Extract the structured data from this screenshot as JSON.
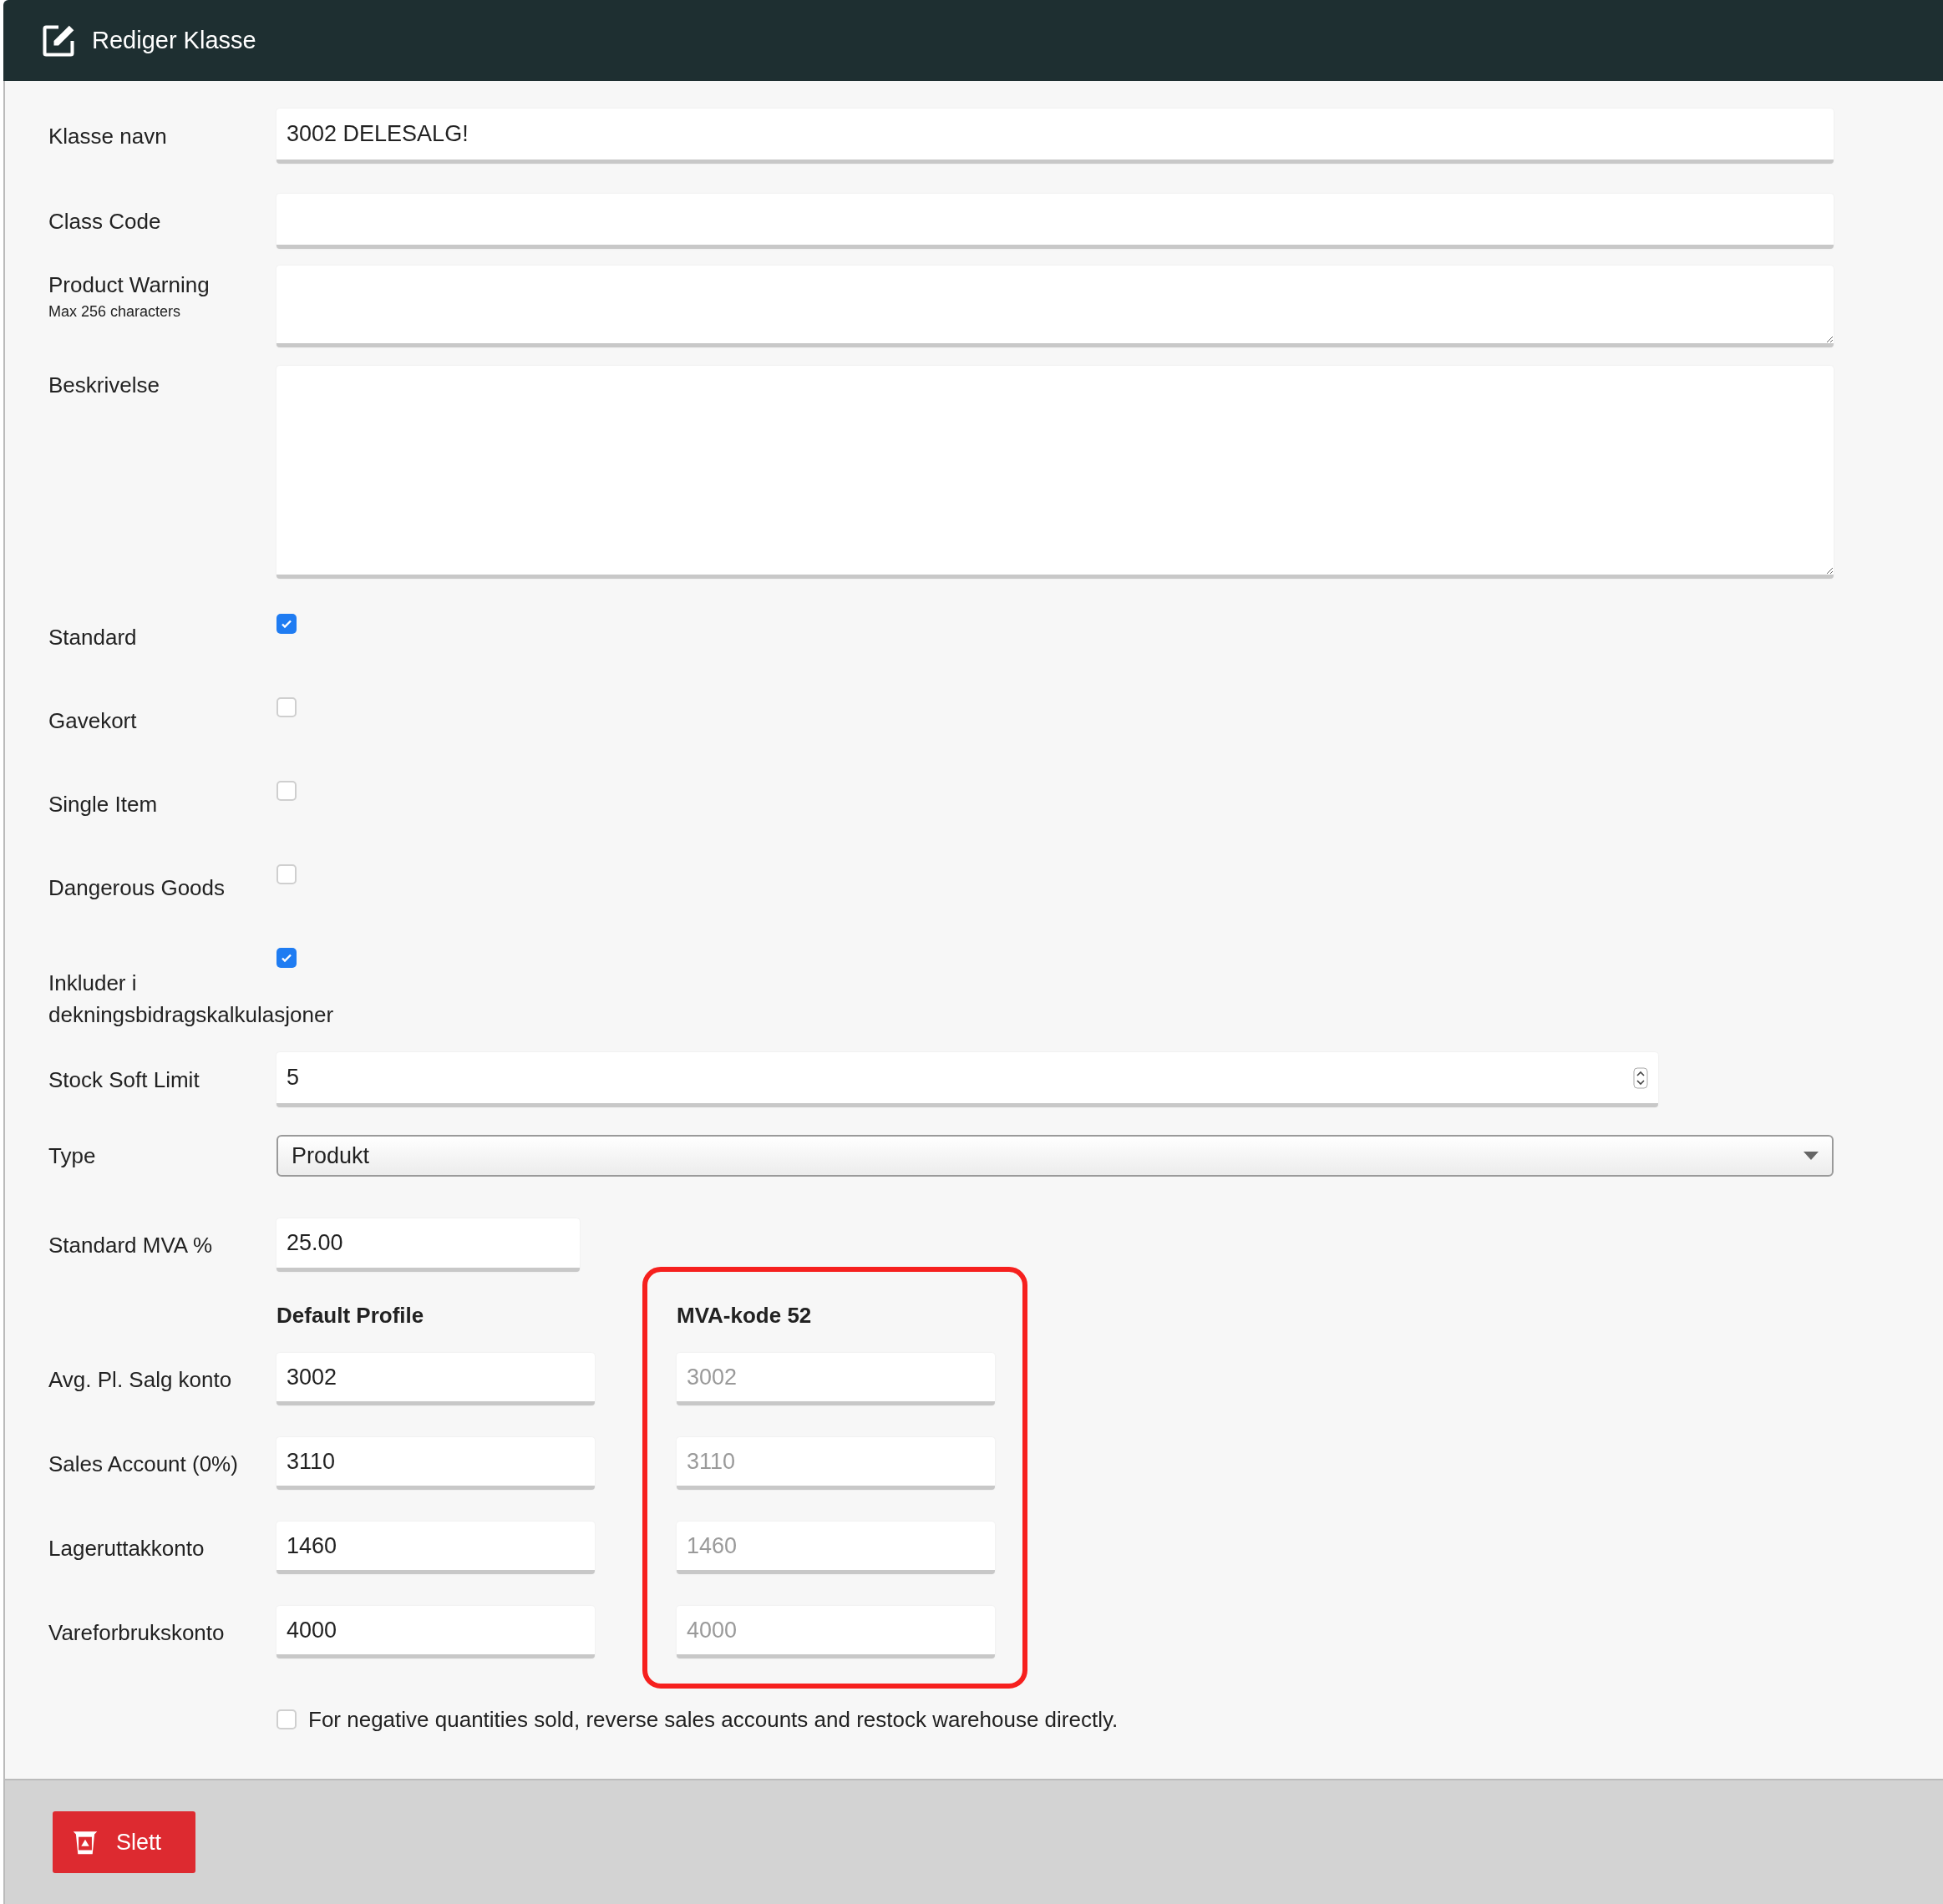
{
  "header": {
    "title": "Rediger Klasse"
  },
  "fields": [
    {
      "kind": "text",
      "label": "Klasse navn",
      "value": "3002 DELESALG!"
    },
    {
      "kind": "text",
      "label": "Class Code"
    },
    {
      "kind": "textarea",
      "label": "Product Warning",
      "hint": "Max 256 characters"
    },
    {
      "kind": "textarea",
      "label": "Beskrivelse"
    },
    {
      "kind": "checkbox",
      "label": "Standard",
      "checked": true
    },
    {
      "kind": "checkbox",
      "label": "Gavekort",
      "checked": false
    },
    {
      "kind": "checkbox",
      "label": "Single Item",
      "checked": false
    },
    {
      "kind": "checkbox",
      "label": "Dangerous Goods",
      "checked": false
    },
    {
      "kind": "checkbox",
      "label": "Inkluder i dekningsbidragskalkulasjoner",
      "checked": true
    },
    {
      "kind": "number",
      "label": "Stock Soft Limit",
      "value": "5"
    },
    {
      "kind": "select",
      "label": "Type",
      "value": "Produkt"
    },
    {
      "kind": "short",
      "label": "Standard MVA %",
      "value": "25.00"
    }
  ],
  "accounts": {
    "columns": [
      {
        "heading": "Default Profile",
        "disabled": false,
        "highlighted": false
      },
      {
        "heading": "MVA-kode 52",
        "disabled": true,
        "highlighted": true
      }
    ],
    "rows": [
      {
        "label": "Avg. Pl. Salg konto",
        "values": [
          "3002",
          "3002"
        ]
      },
      {
        "label": "Sales Account (0%)",
        "values": [
          "3110",
          "3110"
        ]
      },
      {
        "label": "Lageruttakkonto",
        "values": [
          "1460",
          "1460"
        ]
      },
      {
        "label": "Vareforbrukskonto",
        "values": [
          "4000",
          "4000"
        ]
      }
    ]
  },
  "reverse_option": {
    "label": "For negative quantities sold, reverse sales accounts and restock warehouse directly.",
    "checked": false
  },
  "footer": {
    "delete_button": "Slett"
  }
}
